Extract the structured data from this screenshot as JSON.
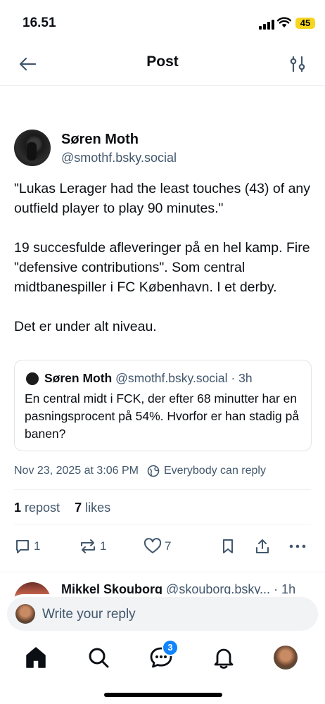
{
  "status_bar": {
    "time": "16.51",
    "battery": "45"
  },
  "header": {
    "title": "Post",
    "back_icon": "arrow-left-icon",
    "filter_icon": "sliders-icon"
  },
  "post": {
    "author_name": "Søren Moth",
    "author_handle": "@smothf.bsky.social",
    "paragraphs": [
      "\"Lukas Lerager had the least touches (43) of any outfield player to play 90 minutes.\"",
      "19 succesfulde afleveringer på en hel kamp. Fire \"defensive contributions\". Som central midtbanespiller i FC København. I et derby.",
      "Det er under alt niveau."
    ],
    "quote": {
      "name": "Søren Moth",
      "handle": "@smothf.bsky.social",
      "time": "· 3h",
      "text": "En central midt i FCK, der efter 68 minutter har en pasningsprocent på 54%. Hvorfor er han stadig på banen?"
    },
    "timestamp": "Nov 23, 2025 at 3:06 PM",
    "reply_setting": "Everybody can reply",
    "repost_count": "1",
    "repost_label": "repost",
    "like_count": "7",
    "like_label": "likes",
    "actions": {
      "reply_count": "1",
      "repost_count": "1",
      "like_count": "7"
    }
  },
  "reply": {
    "name": "Mikkel Skouborg",
    "handle": "@skouborg.bsky...",
    "time": "· 1h"
  },
  "composer": {
    "placeholder": "Write your reply"
  },
  "tabbar": {
    "chat_badge": "3"
  },
  "colors": {
    "accent": "#1083fe",
    "muted": "#42576c",
    "battery": "#f6d51f"
  }
}
